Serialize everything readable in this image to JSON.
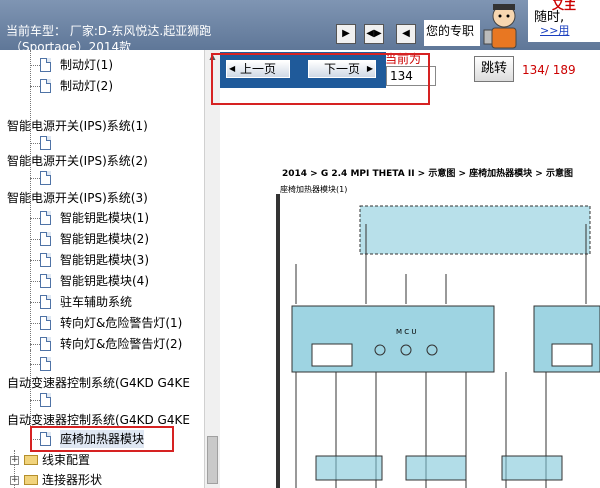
{
  "header": {
    "car_model_line1": "当前车型：  厂家:D-东风悦达.起亚狮跑",
    "car_model_line2": "（Sportage）2014款",
    "expert_text": "您的专职",
    "ad_top": "又主",
    "ad_line1": "随时,",
    "ad_line2": ">>用",
    "nav_icons": [
      "arrow-right-icon",
      "split-icon",
      "arrow-left-icon"
    ]
  },
  "tree": {
    "items": [
      {
        "label": "制动灯(1)",
        "level": 2
      },
      {
        "label": "制动灯(2)",
        "level": 2
      },
      {
        "label": "智能电源开关(IPS)系统(1)",
        "level": 1
      },
      {
        "label": "",
        "level": 2
      },
      {
        "label": "智能电源开关(IPS)系统(2)",
        "level": 1
      },
      {
        "label": "",
        "level": 2
      },
      {
        "label": "智能电源开关(IPS)系统(3)",
        "level": 1
      },
      {
        "label": "智能钥匙模块(1)",
        "level": 2
      },
      {
        "label": "智能钥匙模块(2)",
        "level": 2
      },
      {
        "label": "智能钥匙模块(3)",
        "level": 2
      },
      {
        "label": "智能钥匙模块(4)",
        "level": 2
      },
      {
        "label": "驻车辅助系统",
        "level": 2
      },
      {
        "label": "转向灯&危险警告灯(1)",
        "level": 2
      },
      {
        "label": "转向灯&危险警告灯(2)",
        "level": 2
      },
      {
        "label": "",
        "level": 2
      },
      {
        "label": "自动变速器控制系统(G4KD G4KE",
        "level": 1
      },
      {
        "label": "",
        "level": 2
      },
      {
        "label": "自动变速器控制系统(G4KD G4KE",
        "level": 1
      },
      {
        "label": "座椅加热器模块",
        "level": 2,
        "selected": true
      },
      {
        "label": "线束配置",
        "level": 0,
        "folder": true
      },
      {
        "label": "连接器形状",
        "level": 0,
        "folder": true
      }
    ]
  },
  "toolbar": {
    "prev_label": "上一页",
    "next_label": "下一页",
    "current_label": "当前为",
    "current_value": "134",
    "jump_label": "跳转",
    "page_info": "134/ 189"
  },
  "document": {
    "title": "2014 > G 2.4 MPI THETA II > 示意图 > 座椅加热器模块 > 示意图",
    "subtitle": "座椅加热器模块(1)",
    "mcu_label": "M C U"
  },
  "colors": {
    "accent_red": "#d62222",
    "nav_blue": "#1f5a9a",
    "header_blue": "#6f87a8",
    "module_cyan": "#7ec6d8"
  }
}
